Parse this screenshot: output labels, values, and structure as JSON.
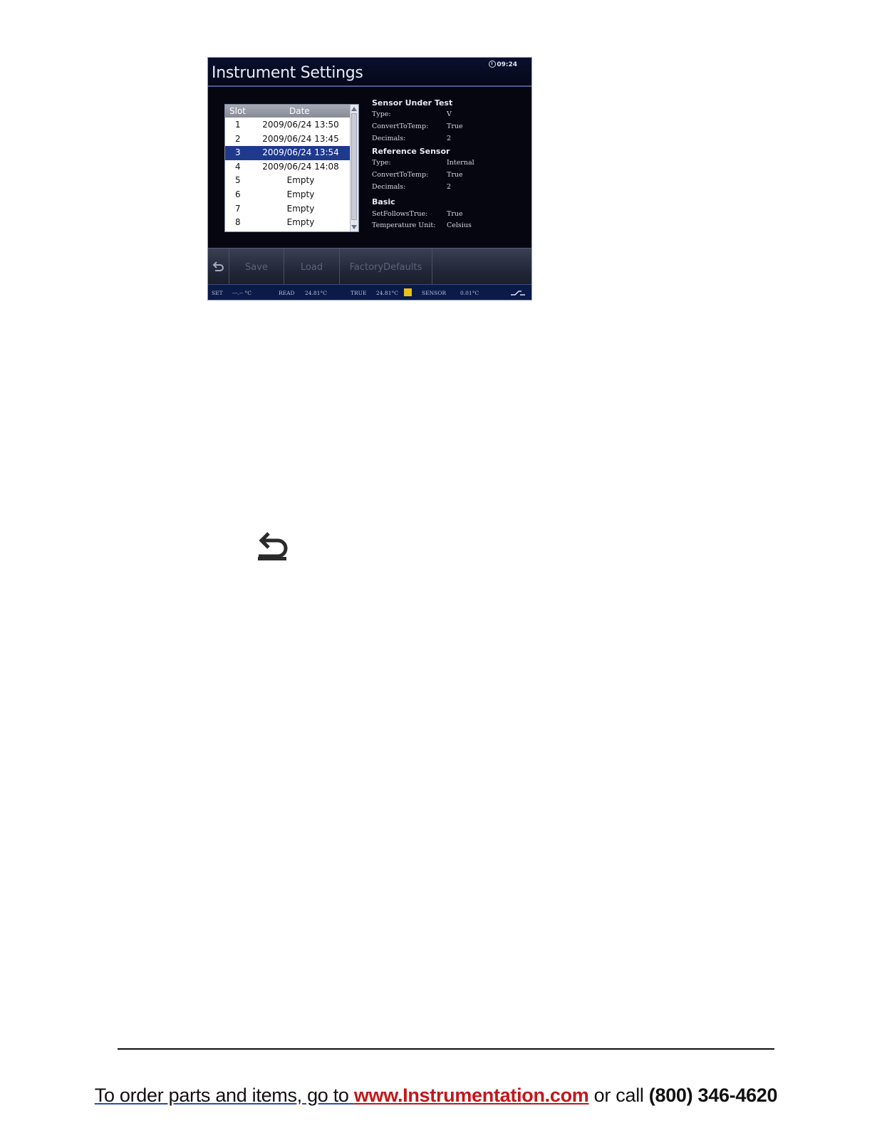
{
  "screen": {
    "title": "Instrument Settings",
    "clock": "09:24",
    "slot_list": {
      "headers": {
        "slot": "Slot",
        "date": "Date"
      },
      "rows": [
        {
          "slot": "1",
          "date": "2009/06/24 13:50"
        },
        {
          "slot": "2",
          "date": "2009/06/24 13:45"
        },
        {
          "slot": "3",
          "date": "2009/06/24 13:54"
        },
        {
          "slot": "4",
          "date": "2009/06/24 14:08"
        },
        {
          "slot": "5",
          "date": "Empty"
        },
        {
          "slot": "6",
          "date": "Empty"
        },
        {
          "slot": "7",
          "date": "Empty"
        },
        {
          "slot": "8",
          "date": "Empty"
        }
      ],
      "selected_slot": "3"
    },
    "details": {
      "sensor_under_test": {
        "heading": "Sensor Under Test",
        "type_label": "Type:",
        "type_value": "V",
        "convert_label": "ConvertToTemp:",
        "convert_value": "True",
        "decimals_label": "Decimals:",
        "decimals_value": "2"
      },
      "reference_sensor": {
        "heading": "Reference Sensor",
        "type_label": "Type:",
        "type_value": "Internal",
        "convert_label": "ConvertToTemp:",
        "convert_value": "True",
        "decimals_label": "Decimals:",
        "decimals_value": "2"
      },
      "basic": {
        "heading": "Basic",
        "setfollows_label": "SetFollowsTrue:",
        "setfollows_value": "True",
        "unit_label": "Temperature Unit:",
        "unit_value": "Celsius"
      }
    },
    "toolbar": {
      "save": "Save",
      "load": "Load",
      "factory_defaults": "FactoryDefaults"
    },
    "status": {
      "set_label": "SET",
      "set_value": "---.-- °C",
      "read_label": "READ",
      "read_value": "24.81°C",
      "true_label": "TRUE",
      "true_value": "24.81°C",
      "sensor_label": "SENSOR",
      "sensor_value": "0.01°C"
    }
  },
  "footer": {
    "text_before": "To order parts and items, go to ",
    "url": "www.Instrumentation.com",
    "text_middle": " or call ",
    "phone": "(800) 346-4620"
  },
  "colors": {
    "selected_row": "#1f3a8c",
    "status_bar": "#0b1a48",
    "url": "#c3161c",
    "status_badge": "#e6c21a"
  }
}
